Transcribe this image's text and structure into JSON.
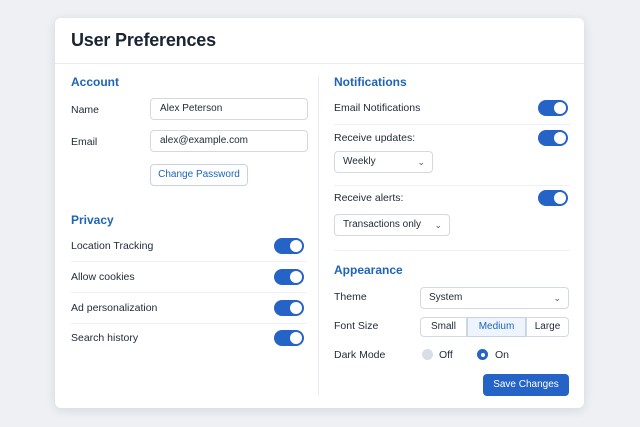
{
  "title": "User Preferences",
  "account": {
    "heading": "Account",
    "name_label": "Name",
    "name_value": "Alex Peterson",
    "email_label": "Email",
    "email_value": "alex@example.com",
    "change_password": "Change Password"
  },
  "privacy": {
    "heading": "Privacy",
    "items": [
      {
        "label": "Location Tracking",
        "on": true
      },
      {
        "label": "Allow cookies",
        "on": true
      },
      {
        "label": "Ad personalization",
        "on": true
      },
      {
        "label": "Search history",
        "on": true
      }
    ]
  },
  "notifications": {
    "heading": "Notifications",
    "email_label": "Email Notifications",
    "email_on": true,
    "updates_label": "Receive updates:",
    "updates_on": true,
    "updates_frequency": "Weekly",
    "alerts_label": "Receive alerts:",
    "alerts_on": true,
    "alerts_type": "Transactions only"
  },
  "appearance": {
    "heading": "Appearance",
    "theme_label": "Theme",
    "theme_value": "System",
    "font_size_label": "Font Size",
    "font_sizes": [
      "Small",
      "Medium",
      "Large"
    ],
    "font_size_selected": "Medium",
    "dark_mode_label": "Dark Mode",
    "dark_mode_off": "Off",
    "dark_mode_on": "On",
    "dark_mode_selected": "On"
  },
  "save_button": "Save Changes",
  "colors": {
    "accent": "#2563c7",
    "heading": "#1e64b8"
  }
}
